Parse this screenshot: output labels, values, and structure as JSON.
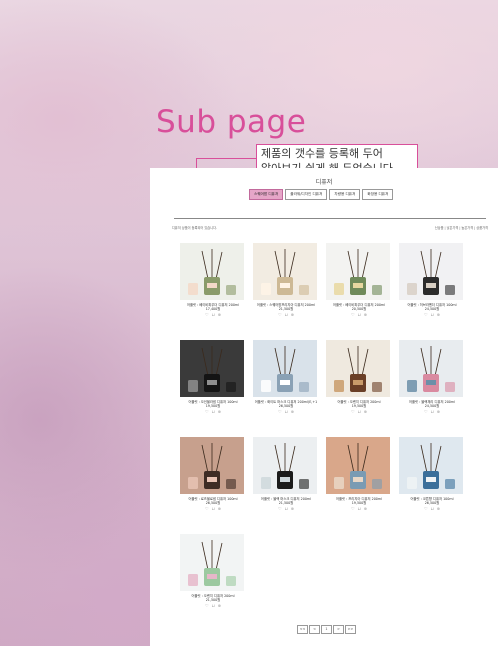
{
  "heading": "Sub page",
  "callout": [
    "제품의 갯수를 등록해 두어",
    "알아보기 쉽게 해 두었습니다."
  ],
  "page_title": "디퓨저",
  "categories": [
    {
      "label": "스퀘어팜 디퓨저",
      "active": true
    },
    {
      "label": "플라워/디자인 디퓨저",
      "active": false
    },
    {
      "label": "차량용 디퓨저",
      "active": false
    },
    {
      "label": "화장용 디퓨저",
      "active": false
    }
  ],
  "count_text": "디퓨저 상품이 등록되어 있습니다.",
  "sort_text": "신상품 | 낮은가격 | 높은가격 | 상품가격",
  "products": [
    {
      "name": "어플릿 : 베이비파우더 디퓨저 200ml",
      "price": "17,400원"
    },
    {
      "name": "어플릿 : 스퀘어팜프리지아 디퓨저 200ml",
      "price": "21,500원"
    },
    {
      "name": "어플릿 : 베이비파우더 디퓨저 200ml",
      "price": "20,500원"
    },
    {
      "name": "어플릿 : 허브라벤더 디퓨저 100ml",
      "price": "24,500원"
    },
    {
      "name": "어플릿 : 오션블라썸 디퓨저 100ml",
      "price": "19,500원"
    },
    {
      "name": "어플릿 : 화이트 머스크 디퓨저 200ml(E,+1",
      "price": "26,500원"
    },
    {
      "name": "어플릿 : 오렌지 디퓨저 200ml",
      "price": "19,500원"
    },
    {
      "name": "어플릿 : 블랙체리 디퓨저 200ml",
      "price": "24,500원"
    },
    {
      "name": "어플릿 : 로즈블로썸 디퓨저 100ml",
      "price": "26,500원"
    },
    {
      "name": "어플릿 : 블랙 머스크 디퓨저 200ml",
      "price": "21,500원"
    },
    {
      "name": "어플릿 : 프리지아 디퓨저 200ml",
      "price": "19,500원"
    },
    {
      "name": "어플릿 : 코튼향 디퓨저 100ml",
      "price": "26,500원"
    },
    {
      "name": "어플릿 : 오렌지 디퓨저 200ml",
      "price": "21,500원"
    }
  ],
  "pager": [
    "<<",
    "<",
    "1",
    ">",
    ">>"
  ],
  "colors": {
    "accent": "#d84f9a",
    "active_tab": "#e6a6c8"
  }
}
